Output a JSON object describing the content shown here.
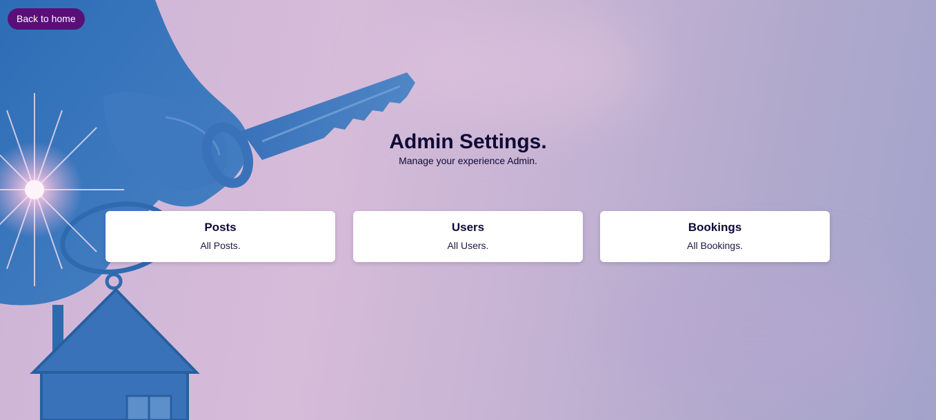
{
  "nav": {
    "back_label": "Back to home"
  },
  "header": {
    "title": "Admin Settings.",
    "subtitle": "Manage your experience Admin."
  },
  "cards": [
    {
      "title": "Posts",
      "description": "All Posts."
    },
    {
      "title": "Users",
      "description": "All Users."
    },
    {
      "title": "Bookings",
      "description": "All Bookings."
    }
  ],
  "colors": {
    "button_bg": "#5a0f78",
    "heading_text": "#0e0a36",
    "card_bg": "#ffffff",
    "hero_tint": "#2f6fb8"
  },
  "icons": {
    "hero": "hand-holding-house-key-image"
  }
}
